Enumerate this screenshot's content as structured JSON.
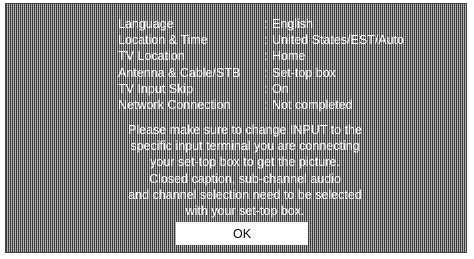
{
  "settings": [
    {
      "label": "Language",
      "value": "English"
    },
    {
      "label": "Location & Time",
      "value": "United States/EST/Auto"
    },
    {
      "label": "TV Location",
      "value": "Home"
    },
    {
      "label": "Antenna & Cable/STB",
      "value": "Set-top box"
    },
    {
      "label": "TV Input Skip",
      "value": "On"
    },
    {
      "label": "Network Connection",
      "value": "Not completed"
    }
  ],
  "separator": ":",
  "message_lines": [
    "Please make sure to change INPUT to the",
    "specific input terminal you are connecting",
    "your set-top box to get the picture.",
    "Closed caption, sub-channel audio",
    "and channel selection need to be selected",
    "with your set-top box."
  ],
  "ok_label": "OK"
}
